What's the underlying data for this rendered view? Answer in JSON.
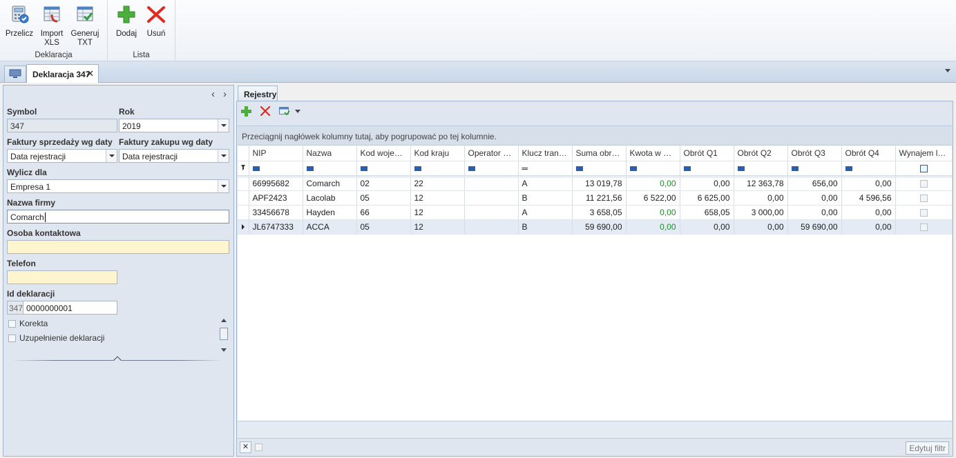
{
  "ribbon": {
    "groups": [
      {
        "title": "Deklaracja",
        "buttons": [
          {
            "label": "Przelicz",
            "icon": "calculator-icon"
          },
          {
            "label": "Import XLS",
            "icon": "import-xls-icon"
          },
          {
            "label": "Generuj TXT",
            "icon": "generate-txt-icon"
          }
        ]
      },
      {
        "title": "Lista",
        "buttons": [
          {
            "label": "Dodaj",
            "icon": "plus-icon"
          },
          {
            "label": "Usuń",
            "icon": "delete-x-icon"
          }
        ]
      }
    ]
  },
  "tabs": {
    "document_tab": "Deklaracja 347",
    "close": "✕"
  },
  "form": {
    "nav_prev": "‹",
    "nav_next": "›",
    "symbol_label": "Symbol",
    "symbol_value": "347",
    "rok_label": "Rok",
    "rok_value": "2019",
    "sales_label": "Faktury sprzedaży wg daty",
    "sales_value": "Data rejestracji",
    "purchase_label": "Faktury zakupu wg daty",
    "purchase_value": "Data rejestracji",
    "wylicz_label": "Wylicz dla",
    "wylicz_value": "Empresa 1",
    "company_label": "Nazwa firmy",
    "company_value": "Comarch",
    "contact_label": "Osoba kontaktowa",
    "contact_value": "",
    "phone_label": "Telefon",
    "phone_value": "",
    "id_label": "Id deklaracji",
    "id_prefix": "347",
    "id_value": "0000000001",
    "korekta_label": "Korekta",
    "uzupelnienie_label": "Uzupełnienie deklaracji"
  },
  "registers": {
    "tab_label": "Rejestry",
    "group_hint": "Przeciągnij nagłówek kolumny tutaj, aby pogrupować po tej kolumnie.",
    "columns": [
      "NIP",
      "Nazwa",
      "Kod wojew...",
      "Kod kraju",
      "Operator w...",
      "Klucz transa...",
      "Suma obrot...",
      "Kwota w go...",
      "Obrót Q1",
      "Obrót Q2",
      "Obrót Q3",
      "Obrót Q4",
      "Wynajem lok..."
    ],
    "filter_eq": "═",
    "rows": [
      [
        "66995682",
        "Comarch",
        "02",
        "22",
        "",
        "A",
        "13 019,78",
        "0,00",
        "0,00",
        "12 363,78",
        "656,00",
        "0,00"
      ],
      [
        "APF2423",
        "Lacolab",
        "05",
        "12",
        "",
        "B",
        "11 221,56",
        "6 522,00",
        "6 625,00",
        "0,00",
        "0,00",
        "4 596,56"
      ],
      [
        "33456678",
        "Hayden",
        "66",
        "12",
        "",
        "A",
        "3 658,05",
        "0,00",
        "658,05",
        "3 000,00",
        "0,00",
        "0,00"
      ],
      [
        "JL6747333",
        "ACCA",
        "05",
        "12",
        "",
        "B",
        "59 690,00",
        "0,00",
        "0,00",
        "0,00",
        "59 690,00",
        "0,00"
      ]
    ],
    "edit_filter": "Edytuj filtr"
  },
  "colors": {
    "accent": "#2b5fa9",
    "green_value": "#1f8a2a",
    "required_field": "#fdf5cd"
  }
}
